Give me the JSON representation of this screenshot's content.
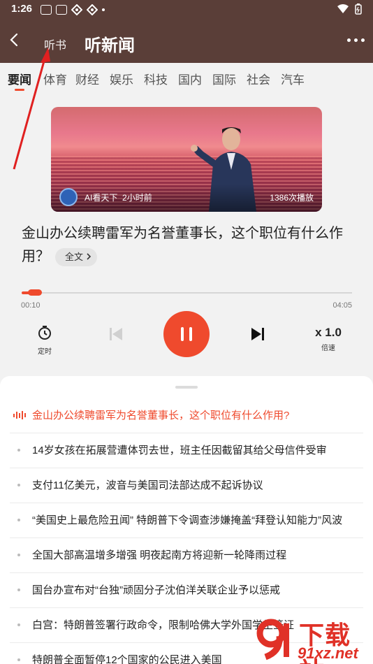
{
  "status_bar": {
    "time": "1:26"
  },
  "header": {
    "tab_audiobook": "听书",
    "tab_news": "听新闻"
  },
  "categories": [
    "要闻",
    "体育",
    "财经",
    "娱乐",
    "科技",
    "国内",
    "国际",
    "社会",
    "汽车"
  ],
  "player": {
    "cover": {
      "source": "AI看天下",
      "time_ago": "2小时前",
      "plays": "1386次播放"
    },
    "title": "金山办公续聘雷军为名誉董事长，这个职位有什么作用？",
    "fulltext_label": "全文",
    "current_time": "00:10",
    "total_time": "04:05",
    "progress": 0.04,
    "timer_label": "定时",
    "speed_value": "x 1.0",
    "speed_label": "倍速",
    "state": "playing"
  },
  "playlist": [
    "金山办公续聘雷军为名誉董事长，这个职位有什么作用?",
    "14岁女孩在拓展营遭体罚去世，班主任因截留其给父母信件受审",
    "支付11亿美元，波音与美国司法部达成不起诉协议",
    "“美国史上最危险丑闻” 特朗普下令调查涉嫌掩盖“拜登认知能力”风波",
    "全国大部高温增多增强 明夜起南方将迎新一轮降雨过程",
    "国台办宣布对“台独”顽固分子沈伯洋关联企业予以惩戒",
    "白宫：特朗普签署行政命令，限制哈佛大学外国学生签证",
    "特朗普全面暂停12个国家的公民进入美国"
  ],
  "watermark": {
    "title": "下载站",
    "url": "91xz.net"
  },
  "colors": {
    "accent": "#ef4a2d",
    "header_bg": "#5a3e38"
  }
}
